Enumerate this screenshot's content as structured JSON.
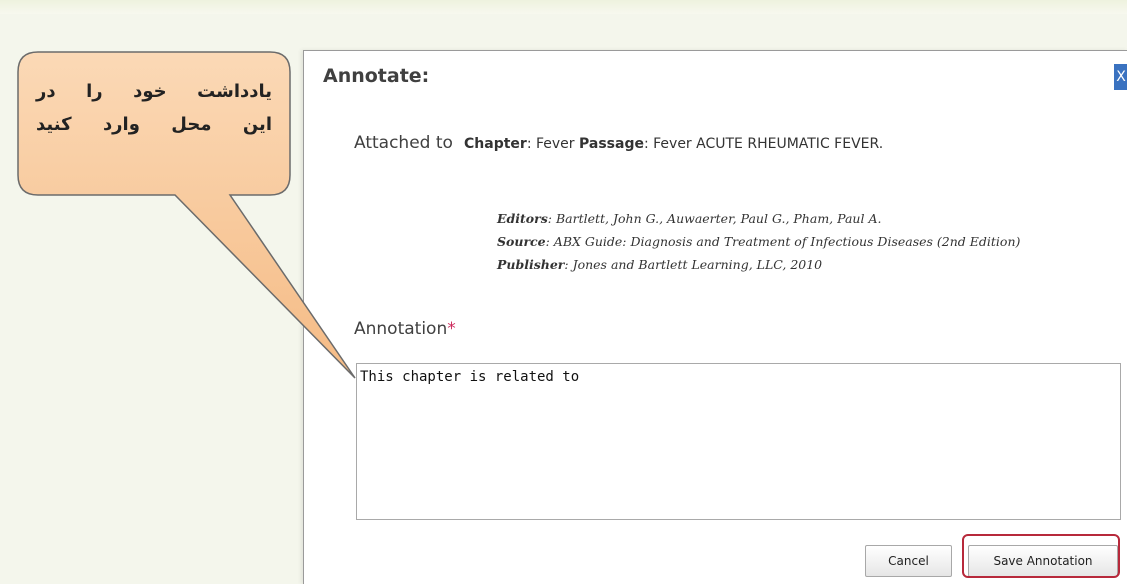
{
  "dialog": {
    "title": "Annotate:",
    "close_label": "X",
    "attached_label": "Attached to",
    "chapter_key": "Chapter",
    "chapter_value": ": Fever ",
    "passage_key": "Passage",
    "passage_value": ": Fever ACUTE RHEUMATIC FEVER.",
    "editors_key": "Editors",
    "editors_value": ": Bartlett, John G., Auwaerter, Paul G., Pham, Paul A.",
    "source_key": "Source",
    "source_value": ": ABX Guide: Diagnosis and Treatment of Infectious Diseases (2nd Edition)",
    "publisher_key": "Publisher",
    "publisher_value": ": Jones and Bartlett Learning, LLC, 2010",
    "annotation_label": "Annotation",
    "required_mark": "*",
    "annotation_value": "This chapter is related to",
    "cancel_label": "Cancel",
    "save_label": "Save Annotation"
  },
  "callout": {
    "line1": "یادداشت خود را در",
    "line2": "این محل وارد کنید",
    "fill_color": "#f8c79a",
    "highlight_color": "#b7293b"
  }
}
